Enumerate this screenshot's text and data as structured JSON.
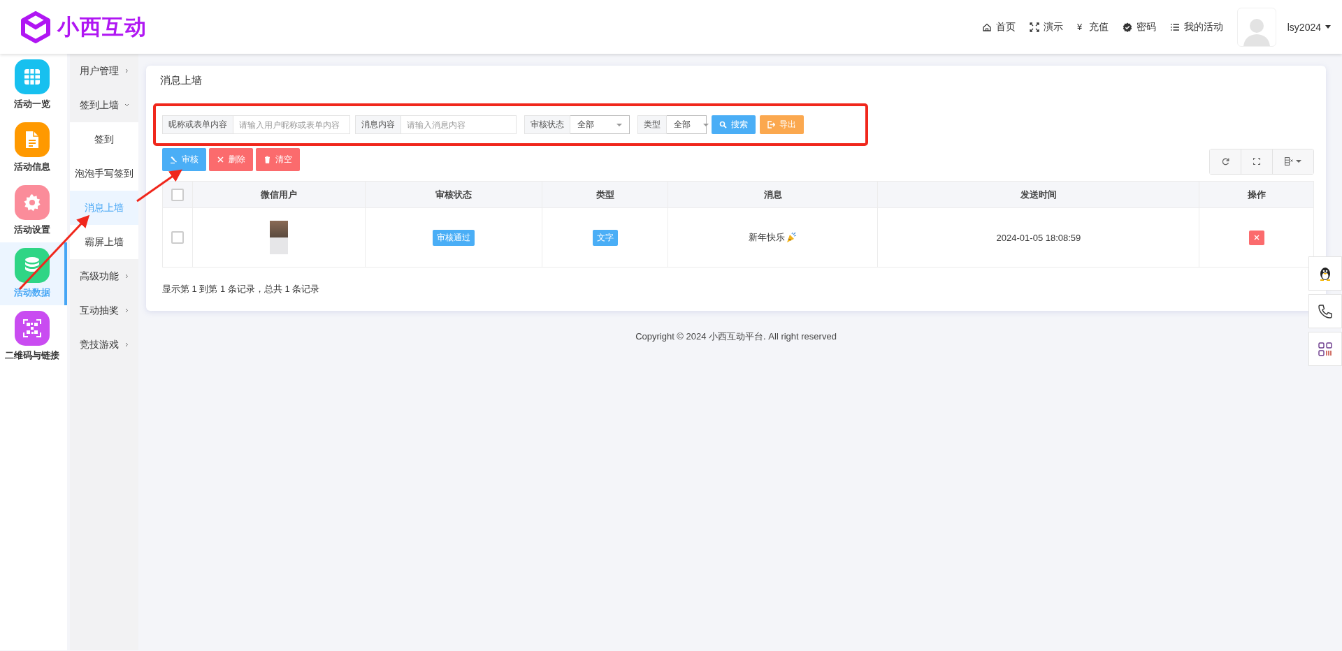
{
  "logo": {
    "text": "小西互动"
  },
  "top_nav": [
    {
      "label": "首页"
    },
    {
      "label": "演示"
    },
    {
      "glyph": "¥",
      "label": "充值"
    },
    {
      "label": "密码"
    },
    {
      "label": "我的活动"
    }
  ],
  "user": {
    "name": "lsy2024"
  },
  "rail": [
    {
      "label": "活动一览",
      "color": "#17c0ef",
      "selected": false
    },
    {
      "label": "活动信息",
      "color": "#ff9900",
      "selected": false
    },
    {
      "label": "活动设置",
      "color": "#fb8c9a",
      "selected": false
    },
    {
      "label": "活动数据",
      "color": "#2fd585",
      "selected": true
    },
    {
      "label": "二维码与链接",
      "color": "#c94cf1",
      "selected": false
    }
  ],
  "submenu": [
    {
      "label": "用户管理",
      "expanded": false
    },
    {
      "label": "签到上墙",
      "expanded": true,
      "children": [
        {
          "label": "签到",
          "selected": false
        },
        {
          "label": "泡泡手写签到",
          "selected": false
        },
        {
          "label": "消息上墙",
          "selected": true
        },
        {
          "label": "霸屏上墙",
          "selected": false
        }
      ]
    },
    {
      "label": "高级功能",
      "expanded": false
    },
    {
      "label": "互动抽奖",
      "expanded": false
    },
    {
      "label": "竞技游戏",
      "expanded": false
    }
  ],
  "card": {
    "title": "消息上墙"
  },
  "filters": [
    {
      "kind": "text",
      "label": "昵称或表单内容",
      "placeholder": "请输入用户昵称或表单内容"
    },
    {
      "kind": "text",
      "label": "消息内容",
      "placeholder": "请输入消息内容"
    },
    {
      "kind": "select",
      "label": "审核状态",
      "value": "全部"
    },
    {
      "kind": "select",
      "label": "类型",
      "value": "全部"
    }
  ],
  "filter_buttons": [
    {
      "kind": "search",
      "label": "搜索"
    },
    {
      "kind": "export",
      "label": "导出"
    }
  ],
  "actions": [
    {
      "kind": "approve",
      "label": "审核"
    },
    {
      "kind": "delete",
      "label": "删除"
    },
    {
      "kind": "clear",
      "label": "清空"
    }
  ],
  "table": {
    "header_checked": false,
    "columns": [
      "微信用户",
      "审核状态",
      "类型",
      "消息",
      "发送时间",
      "操作"
    ],
    "rows": [
      {
        "checked": false,
        "status": "审核通过",
        "type": "文字",
        "message": "新年快乐",
        "time": "2024-01-05 18:08:59"
      }
    ]
  },
  "pagination": "显示第 1 到第 1 条记录，总共 1 条记录",
  "footer": "Copyright © 2024 小西互动平台. All right reserved"
}
